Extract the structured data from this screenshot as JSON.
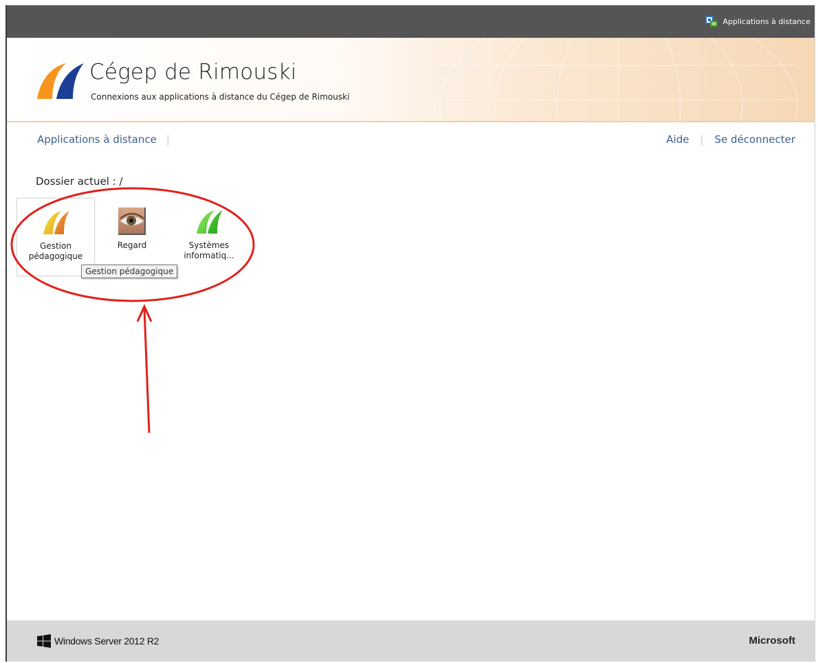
{
  "topbar": {
    "link_label": "Applications à distance",
    "icon": "remote-desktop-icon"
  },
  "banner": {
    "title": "Cégep de Rimouski",
    "subtitle": "Connexions aux applications à distance du Cégep de Rimouski",
    "logo_icon": "cegep-logo-icon",
    "colors": {
      "logo_orange": "#f7941d",
      "logo_blue": "#1b3f94"
    }
  },
  "nav": {
    "left": [
      {
        "label": "Applications à distance"
      }
    ],
    "right": [
      {
        "label": "Aide"
      },
      {
        "label": "Se déconnecter"
      }
    ],
    "link_color": "#3a5f8a"
  },
  "folder": {
    "label": "Dossier actuel : /"
  },
  "apps": [
    {
      "label_line1": "Gestion",
      "label_line2": "pédagogique",
      "icon": "gestion-pedagogique-icon",
      "selected": true
    },
    {
      "label_line1": "Regard",
      "label_line2": "",
      "icon": "regard-eye-icon",
      "selected": false
    },
    {
      "label_line1": "Systèmes",
      "label_line2": "informatiq...",
      "icon": "systemes-informatiques-icon",
      "selected": false
    }
  ],
  "tooltip": {
    "text": "Gestion pédagogique"
  },
  "footer": {
    "os_label": "Windows Server 2012 R2",
    "vendor": "Microsoft",
    "os_icon": "windows-logo-icon"
  },
  "annotation_color": "#e0201c"
}
